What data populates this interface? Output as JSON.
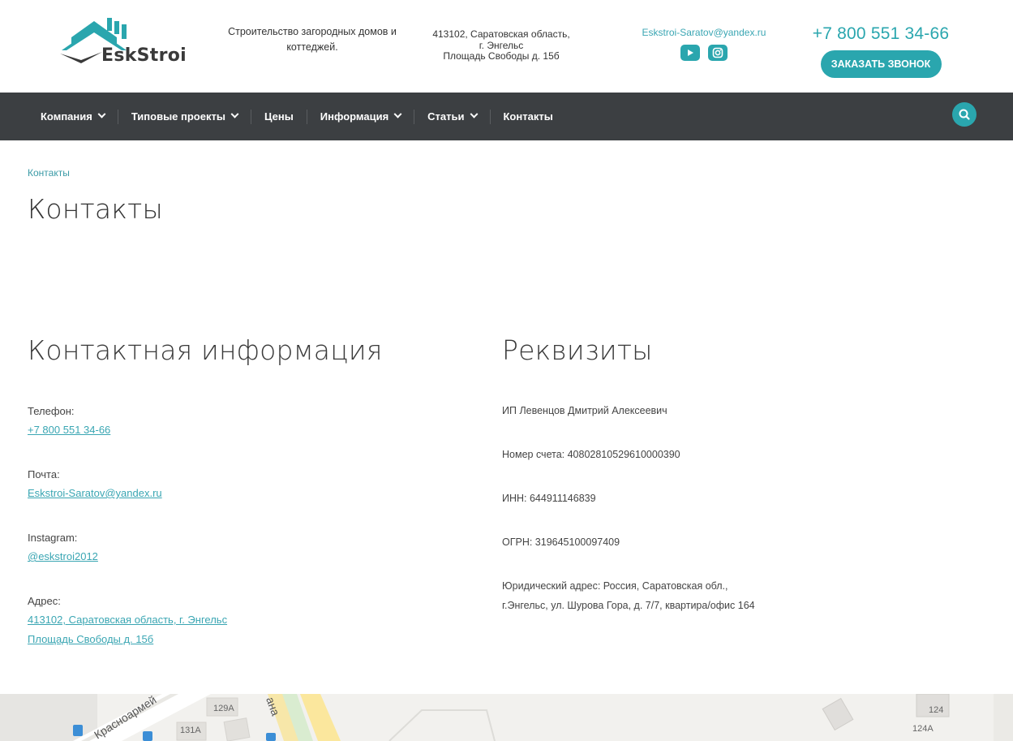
{
  "header": {
    "logo_text": "EskStroi",
    "tagline": "Строительство загородных домов и коттеджей.",
    "address_lines": [
      "413102, Саратовская область,",
      "г. Энгельс",
      "Площадь Свободы д. 15б"
    ],
    "email": "Eskstroi-Saratov@yandex.ru",
    "phone": "+7 800 551 34-66",
    "call_button": "ЗАКАЗАТЬ ЗВОНОК",
    "brand_color": "#2aa6ae"
  },
  "nav": {
    "items": [
      {
        "label": "Компания",
        "dropdown": true
      },
      {
        "label": "Типовые проекты",
        "dropdown": true
      },
      {
        "label": "Цены",
        "dropdown": false
      },
      {
        "label": "Информация",
        "dropdown": true
      },
      {
        "label": "Статьи",
        "dropdown": true
      },
      {
        "label": "Контакты",
        "dropdown": false
      }
    ],
    "background": "#3c3f42"
  },
  "breadcrumb": "Контакты",
  "page_title": "Контакты",
  "contacts": {
    "title": "Контактная информация",
    "phone_label": "Телефон:",
    "phone_value": "+7 800 551 34-66",
    "email_label": "Почта:",
    "email_value": "Eskstroi-Saratov@yandex.ru",
    "instagram_label": "Instagram:",
    "instagram_value": "@eskstroi2012",
    "address_label": "Адрес:",
    "address_line1": "413102, Саратовская область, г. Энгельс",
    "address_line2": "Площадь Свободы д. 15б"
  },
  "requisites": {
    "title": "Реквизиты",
    "owner": "ИП Левенцов Дмитрий Алексеевич",
    "account": "Номер счета: 40802810529610000390",
    "inn": "ИНН: 644911146839",
    "ogrn": "ОГРН: 319645100097409",
    "legal_address_line1": "Юридический адрес: Россия, Саратовская обл.,",
    "legal_address_line2": "г.Энгельс, ул. Шурова Гора, д. 7/7, квартира/офис 164"
  },
  "map": {
    "labels": [
      "Красноармей",
      "ана",
      "129А",
      "131А",
      "124",
      "124А"
    ]
  }
}
